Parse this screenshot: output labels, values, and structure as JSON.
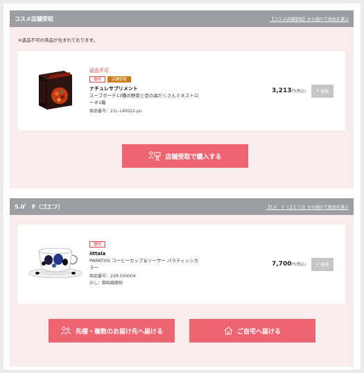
{
  "sections": [
    {
      "title": "コスメ店舗受取",
      "link": "【コスメ店舗受取】から続けて商品を選ぶ",
      "notice": "※返品不可の商品が含まれております。",
      "item": {
        "nonreturn": "返品不可",
        "badge1": "優待",
        "badge2": "店舗受取",
        "brand": "ナチュレサプリメント",
        "name": "スープボーテ13種の野菜と豆の具だくさんミネストローネ1箱",
        "code": "商品番号：21L-140022-pu",
        "price": "3,213",
        "unit": "円(税込)",
        "delete": "削除"
      },
      "action": "店舗受取で購入する"
    },
    {
      "title": "5.0゜ F（ゴエフ）",
      "link": "【5.0゜ F（ゴエフ）】から続けて商品を選ぶ",
      "item": {
        "badge1": "優待",
        "brand": "iittala",
        "name": "PARATIISI コーヒーカップ＆ソーサー パラティッシカラー",
        "code": "商品番号：22R-500004",
        "noshi": "のし：御結婚御祝",
        "price": "7,700",
        "unit": "円(税込)",
        "delete": "削除"
      },
      "action_multi": "先様・複数のお届け先へ届ける",
      "action_home": "ご自宅へ届ける"
    }
  ],
  "colors": {
    "header": "#9c9ea3",
    "section_bg": "#f9ecec",
    "accent": "#ee6470",
    "badge_red": "#e0404c",
    "badge_store": "#c87b10",
    "delete_bg": "#c6c6c6"
  },
  "icons": [
    "store-pickup-icon",
    "users-icon",
    "home-icon",
    "close-icon"
  ]
}
